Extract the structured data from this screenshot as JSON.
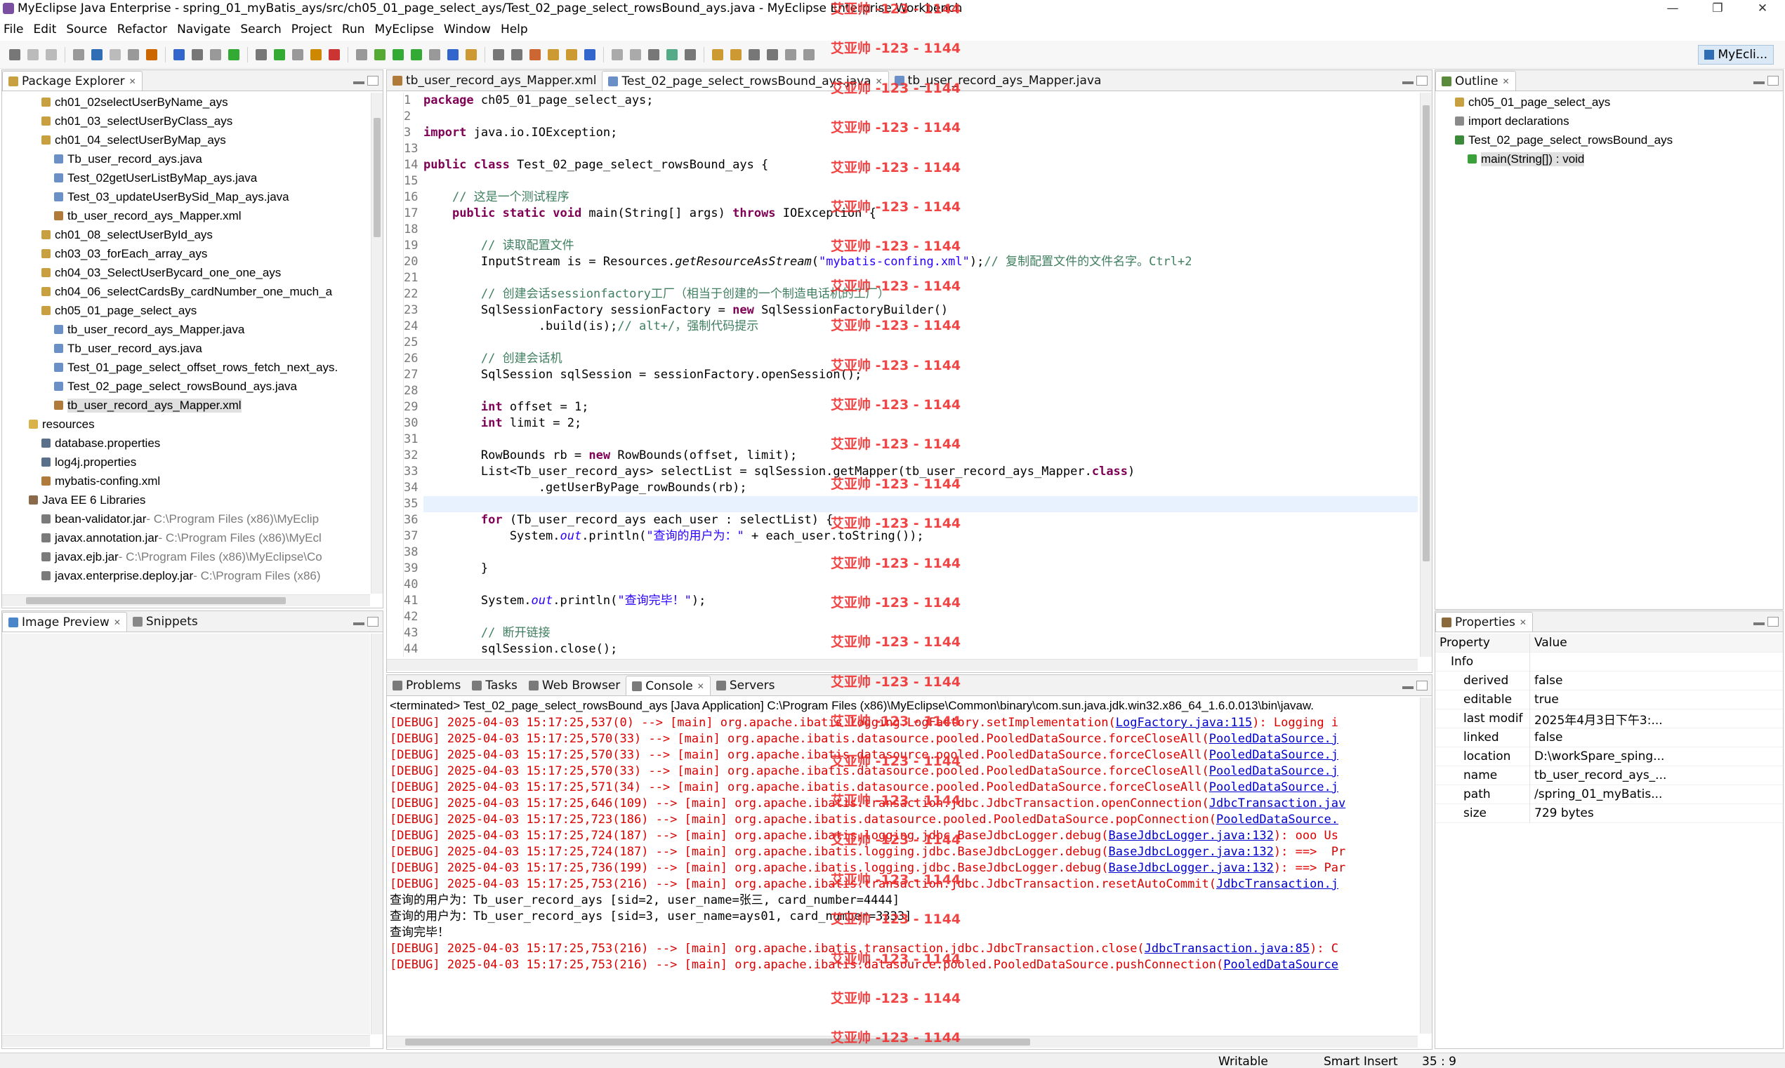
{
  "window": {
    "title": "MyEclipse Java Enterprise - spring_01_myBatis_ays/src/ch05_01_page_select_ays/Test_02_page_select_rowsBound_ays.java - MyEclipse Enterprise Workbench",
    "minimize": "—",
    "maximize": "❐",
    "close": "✕"
  },
  "menu": [
    "File",
    "Edit",
    "Source",
    "Refactor",
    "Navigate",
    "Search",
    "Project",
    "Run",
    "MyEclipse",
    "Window",
    "Help"
  ],
  "perspective": "MyEcli...",
  "package_explorer": {
    "tab": "Package Explorer",
    "items": [
      {
        "label": "ch01_02selectUserByName_ays",
        "indent": 1,
        "icon": "package-icon"
      },
      {
        "label": "ch01_03_selectUserByClass_ays",
        "indent": 1,
        "icon": "package-icon"
      },
      {
        "label": "ch01_04_selectUserByMap_ays",
        "indent": 1,
        "icon": "package-icon"
      },
      {
        "label": "Tb_user_record_ays.java",
        "indent": 2,
        "icon": "java-file-icon"
      },
      {
        "label": "Test_02getUserListByMap_ays.java",
        "indent": 2,
        "icon": "java-file-icon"
      },
      {
        "label": "Test_03_updateUserBySid_Map_ays.java",
        "indent": 2,
        "icon": "java-file-icon"
      },
      {
        "label": "tb_user_record_ays_Mapper.xml",
        "indent": 2,
        "icon": "xml-file-icon"
      },
      {
        "label": "ch01_08_selectUserById_ays",
        "indent": 1,
        "icon": "package-icon"
      },
      {
        "label": "ch03_03_forEach_array_ays",
        "indent": 1,
        "icon": "package-icon"
      },
      {
        "label": "ch04_03_SelectUserBycard_one_one_ays",
        "indent": 1,
        "icon": "package-icon"
      },
      {
        "label": "ch04_06_selectCardsBy_cardNumber_one_much_a",
        "indent": 1,
        "icon": "package-icon"
      },
      {
        "label": "ch05_01_page_select_ays",
        "indent": 1,
        "icon": "package-icon"
      },
      {
        "label": "tb_user_record_ays_Mapper.java",
        "indent": 2,
        "icon": "java-file-icon"
      },
      {
        "label": "Tb_user_record_ays.java",
        "indent": 2,
        "icon": "java-file-icon"
      },
      {
        "label": "Test_01_page_select_offset_rows_fetch_next_ays.",
        "indent": 2,
        "icon": "java-file-icon"
      },
      {
        "label": "Test_02_page_select_rowsBound_ays.java",
        "indent": 2,
        "icon": "java-file-icon"
      },
      {
        "label": "tb_user_record_ays_Mapper.xml",
        "indent": 2,
        "icon": "xml-file-icon",
        "selected": true
      },
      {
        "label": "resources",
        "indent": 0,
        "icon": "folder-icon"
      },
      {
        "label": "database.properties",
        "indent": 1,
        "icon": "properties-file-icon"
      },
      {
        "label": "log4j.properties",
        "indent": 1,
        "icon": "properties-file-icon"
      },
      {
        "label": "mybatis-confing.xml",
        "indent": 1,
        "icon": "xml-file-icon"
      },
      {
        "label": "Java EE 6 Libraries",
        "indent": 0,
        "icon": "library-icon"
      },
      {
        "label": "bean-validator.jar",
        "suffix": " - C:\\Program Files (x86)\\MyEclip",
        "indent": 1,
        "icon": "jar-icon"
      },
      {
        "label": "javax.annotation.jar",
        "suffix": " - C:\\Program Files (x86)\\MyEcl",
        "indent": 1,
        "icon": "jar-icon"
      },
      {
        "label": "javax.ejb.jar",
        "suffix": " - C:\\Program Files (x86)\\MyEclipse\\Co",
        "indent": 1,
        "icon": "jar-icon"
      },
      {
        "label": "javax.enterprise.deploy.jar",
        "suffix": " - C:\\Program Files (x86)",
        "indent": 1,
        "icon": "jar-icon"
      }
    ]
  },
  "image_preview": {
    "tabs": [
      "Image Preview",
      "Snippets"
    ]
  },
  "editor": {
    "tabs": [
      {
        "label": "tb_user_record_ays_Mapper.xml",
        "active": false
      },
      {
        "label": "Test_02_page_select_rowsBound_ays.java",
        "active": true
      },
      {
        "label": "tb_user_record_ays_Mapper.java",
        "active": false
      }
    ],
    "lines": [
      {
        "n": "1",
        "html": "<span class='kw'>package</span> ch05_01_page_select_ays;"
      },
      {
        "n": "2",
        "html": ""
      },
      {
        "n": "3",
        "html": "<span class='kw'>import</span> java.io.IOException;"
      },
      {
        "n": "13",
        "html": ""
      },
      {
        "n": "14",
        "html": "<span class='kw'>public class</span> Test_02_page_select_rowsBound_ays {"
      },
      {
        "n": "15",
        "html": ""
      },
      {
        "n": "16",
        "html": "    <span class='cm'>// 这是一个测试程序</span>"
      },
      {
        "n": "17",
        "html": "    <span class='kw'>public static void</span> main(String[] args) <span class='kw'>throws</span> IOException {"
      },
      {
        "n": "18",
        "html": ""
      },
      {
        "n": "19",
        "html": "        <span class='cm'>// 读取配置文件</span>"
      },
      {
        "n": "20",
        "html": "        InputStream is = Resources.<span class='it'>getResourceAsStream</span>(<span class='st'>\"mybatis-confing.xml\"</span>);<span class='cm'>// 复制配置文件的文件名字。Ctrl+2</span>"
      },
      {
        "n": "21",
        "html": ""
      },
      {
        "n": "22",
        "html": "        <span class='cm'>// 创建会话sessionfactory工厂（相当于创建的一个制造电话机的工厂）</span>"
      },
      {
        "n": "23",
        "html": "        SqlSessionFactory sessionFactory = <span class='kw'>new</span> SqlSessionFactoryBuilder()"
      },
      {
        "n": "24",
        "html": "                .build(is);<span class='cm'>// alt+/，强制代码提示</span>"
      },
      {
        "n": "25",
        "html": ""
      },
      {
        "n": "26",
        "html": "        <span class='cm'>// 创建会话机</span>"
      },
      {
        "n": "27",
        "html": "        SqlSession sqlSession = sessionFactory.openSession();"
      },
      {
        "n": "28",
        "html": ""
      },
      {
        "n": "29",
        "html": "        <span class='kw'>int</span> offset = 1;"
      },
      {
        "n": "30",
        "html": "        <span class='kw'>int</span> limit = 2;"
      },
      {
        "n": "31",
        "html": ""
      },
      {
        "n": "32",
        "html": "        RowBounds rb = <span class='kw'>new</span> RowBounds(offset, limit);"
      },
      {
        "n": "33",
        "html": "        List&lt;Tb_user_record_ays&gt; selectList = sqlSession.getMapper(tb_user_record_ays_Mapper.<span class='kw'>class</span>)"
      },
      {
        "n": "34",
        "html": "                .getUserByPage_rowBounds(rb);"
      },
      {
        "n": "35",
        "html": ""
      },
      {
        "n": "36",
        "html": "        <span class='kw'>for</span> (Tb_user_record_ays each_user : selectList) {"
      },
      {
        "n": "37",
        "html": "            System.<span class='st it'>out</span>.println(<span class='st'>\"查询的用户为：\"</span> + each_user.toString());"
      },
      {
        "n": "38",
        "html": ""
      },
      {
        "n": "39",
        "html": "        }"
      },
      {
        "n": "40",
        "html": ""
      },
      {
        "n": "41",
        "html": "        System.<span class='st it'>out</span>.println(<span class='st'>\"查询完毕！\"</span>);"
      },
      {
        "n": "42",
        "html": ""
      },
      {
        "n": "43",
        "html": "        <span class='cm'>// 断开链接</span>"
      },
      {
        "n": "44",
        "html": "        sqlSession.close();"
      }
    ]
  },
  "outline": {
    "tab": "Outline",
    "items": [
      {
        "label": "ch05_01_page_select_ays",
        "indent": 0,
        "icon": "package-icon"
      },
      {
        "label": "import declarations",
        "indent": 0,
        "icon": "imports-icon"
      },
      {
        "label": "Test_02_page_select_rowsBound_ays",
        "indent": 0,
        "icon": "class-icon"
      },
      {
        "label": "main(String[]) : void",
        "indent": 1,
        "icon": "method-icon",
        "selected": true
      }
    ]
  },
  "properties": {
    "tab": "Properties",
    "header": {
      "property": "Property",
      "value": "Value"
    },
    "group": "Info",
    "rows": [
      {
        "k": "derived",
        "v": "false"
      },
      {
        "k": "editable",
        "v": "true"
      },
      {
        "k": "last modif",
        "v": "2025年4月3日下午3:..."
      },
      {
        "k": "linked",
        "v": "false"
      },
      {
        "k": "location",
        "v": "D:\\workSpare_sping..."
      },
      {
        "k": "name",
        "v": "tb_user_record_ays_..."
      },
      {
        "k": "path",
        "v": "/spring_01_myBatis..."
      },
      {
        "k": "size",
        "v": "729  bytes"
      }
    ]
  },
  "console": {
    "tabs": [
      "Problems",
      "Tasks",
      "Web Browser",
      "Console",
      "Servers"
    ],
    "active_tab": "Console",
    "header": "<terminated> Test_02_page_select_rowsBound_ays [Java Application] C:\\Program Files (x86)\\MyEclipse\\Common\\binary\\com.sun.java.jdk.win32.x86_64_1.6.0.013\\bin\\javaw.",
    "lines": [
      {
        "cls": "dbg",
        "html": "[DEBUG] 2025-04-03 15:17:25,537(0) --> [main] org.apache.ibatis.logging.LogFactory.setImplementation(<span class='lnk'>LogFactory.java:115</span>): Logging i"
      },
      {
        "cls": "dbg",
        "html": "[DEBUG] 2025-04-03 15:17:25,570(33) --> [main] org.apache.ibatis.datasource.pooled.PooledDataSource.forceCloseAll(<span class='lnk'>PooledDataSource.j</span>"
      },
      {
        "cls": "dbg",
        "html": "[DEBUG] 2025-04-03 15:17:25,570(33) --> [main] org.apache.ibatis.datasource.pooled.PooledDataSource.forceCloseAll(<span class='lnk'>PooledDataSource.j</span>"
      },
      {
        "cls": "dbg",
        "html": "[DEBUG] 2025-04-03 15:17:25,570(33) --> [main] org.apache.ibatis.datasource.pooled.PooledDataSource.forceCloseAll(<span class='lnk'>PooledDataSource.j</span>"
      },
      {
        "cls": "dbg",
        "html": "[DEBUG] 2025-04-03 15:17:25,571(34) --> [main] org.apache.ibatis.datasource.pooled.PooledDataSource.forceCloseAll(<span class='lnk'>PooledDataSource.j</span>"
      },
      {
        "cls": "dbg",
        "html": "[DEBUG] 2025-04-03 15:17:25,646(109) --> [main] org.apache.ibatis.transaction.jdbc.JdbcTransaction.openConnection(<span class='lnk'>JdbcTransaction.jav</span>"
      },
      {
        "cls": "dbg",
        "html": "[DEBUG] 2025-04-03 15:17:25,723(186) --> [main] org.apache.ibatis.datasource.pooled.PooledDataSource.popConnection(<span class='lnk'>PooledDataSource.</span>"
      },
      {
        "cls": "dbg",
        "html": "[DEBUG] 2025-04-03 15:17:25,724(187) --> [main] org.apache.ibatis.logging.jdbc.BaseJdbcLogger.debug(<span class='lnk'>BaseJdbcLogger.java:132</span>): ooo Us"
      },
      {
        "cls": "dbg",
        "html": "[DEBUG] 2025-04-03 15:17:25,724(187) --> [main] org.apache.ibatis.logging.jdbc.BaseJdbcLogger.debug(<span class='lnk'>BaseJdbcLogger.java:132</span>): ==>  Pr"
      },
      {
        "cls": "dbg",
        "html": "[DEBUG] 2025-04-03 15:17:25,736(199) --> [main] org.apache.ibatis.logging.jdbc.BaseJdbcLogger.debug(<span class='lnk'>BaseJdbcLogger.java:132</span>): ==> Par"
      },
      {
        "cls": "dbg",
        "html": "[DEBUG] 2025-04-03 15:17:25,753(216) --> [main] org.apache.ibatis.transaction.jdbc.JdbcTransaction.resetAutoCommit(<span class='lnk'>JdbcTransaction.j</span>"
      },
      {
        "cls": "out",
        "html": "查询的用户为：Tb_user_record_ays [sid=2, user_name=张三, card_number=4444]"
      },
      {
        "cls": "out",
        "html": "查询的用户为：Tb_user_record_ays [sid=3, user_name=ays01, card_number=3333]"
      },
      {
        "cls": "out",
        "html": "查询完毕！"
      },
      {
        "cls": "dbg",
        "html": "[DEBUG] 2025-04-03 15:17:25,753(216) --> [main] org.apache.ibatis.transaction.jdbc.JdbcTransaction.close(<span class='lnk'>JdbcTransaction.java:85</span>): C"
      },
      {
        "cls": "dbg",
        "html": "[DEBUG] 2025-04-03 15:17:25,753(216) --> [main] org.apache.ibatis.datasource.pooled.PooledDataSource.pushConnection(<span class='lnk'>PooledDataSource</span>"
      }
    ]
  },
  "status": {
    "writable": "Writable",
    "insert": "Smart Insert",
    "position": "35 : 9"
  },
  "watermark": "艾亚帅 -123 - 1144",
  "colors": {
    "accent": "#2f6db4",
    "debug": "#dd0000",
    "keyword": "#7f0055",
    "comment": "#3f7f5f",
    "string": "#2a00ff"
  }
}
